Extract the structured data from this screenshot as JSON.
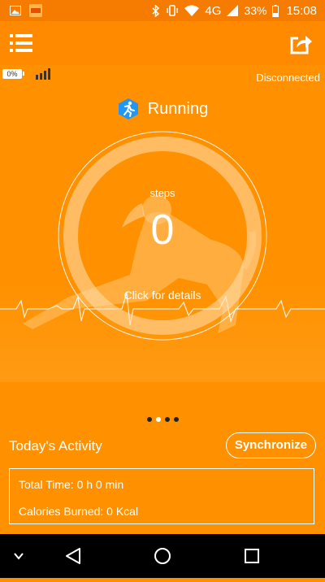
{
  "status_bar": {
    "battery_percent": "33%",
    "network": "4G",
    "time": "15:08",
    "icons": [
      "image-icon",
      "app-icon",
      "bluetooth-icon",
      "vibrate-icon",
      "wifi-icon",
      "cell-signal-icon",
      "battery-icon"
    ]
  },
  "app_bar": {
    "menu_icon": "list-menu-icon",
    "share_icon": "share-icon"
  },
  "device": {
    "battery_label": "0%",
    "connection_status": "Disconnected"
  },
  "mode": {
    "icon": "running-icon",
    "label": "Running"
  },
  "counter": {
    "unit_label": "steps",
    "value": "0",
    "details_link": "Click for details"
  },
  "pager": {
    "count": 4,
    "active_index": 1
  },
  "activity": {
    "title": "Today's Activity",
    "sync_button": "Synchronize",
    "total_time": "Total Time: 0 h 0 min",
    "calories": "Calories Burned: 0 Kcal"
  },
  "nav_bar": {
    "icons": [
      "collapse-icon",
      "back-icon",
      "home-icon",
      "recents-icon"
    ]
  },
  "colors": {
    "status_bar": "#f57c00",
    "app_bar": "#ff8a00",
    "background": "#ff9100",
    "mode_icon": "#2196f3"
  }
}
